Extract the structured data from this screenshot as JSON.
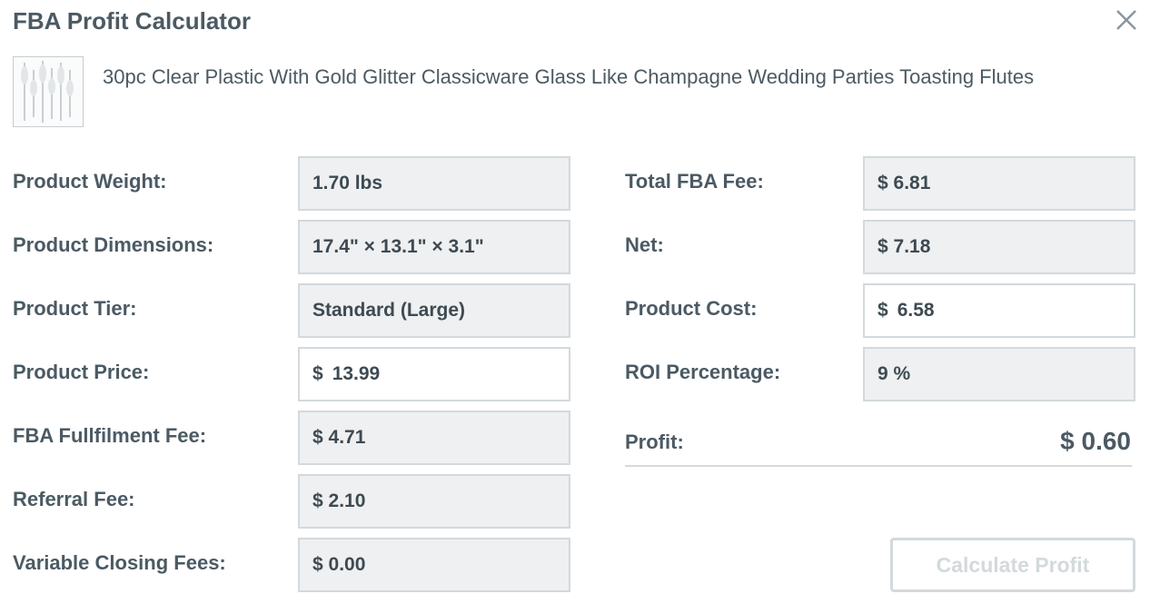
{
  "dialog": {
    "title": "FBA Profit Calculator",
    "product_name": "30pc Clear Plastic With Gold Glitter Classicware Glass Like Champagne Wedding Parties Toasting Flutes"
  },
  "left_fields": [
    {
      "label": "Product Weight:",
      "value": "1.70 lbs"
    },
    {
      "label": "Product Dimensions:",
      "value": "17.4\" × 13.1\" × 3.1\""
    },
    {
      "label": "Product Tier:",
      "value": "Standard (Large)"
    },
    {
      "label": "Product Price:",
      "currency": "$",
      "value": "13.99"
    },
    {
      "label": "FBA Fullfilment Fee:",
      "value": "$ 4.71"
    },
    {
      "label": "Referral Fee:",
      "value": "$ 2.10"
    },
    {
      "label": "Variable Closing Fees:",
      "value": "$ 0.00"
    }
  ],
  "right_fields": [
    {
      "label": "Total FBA Fee:",
      "value": "$ 6.81"
    },
    {
      "label": "Net:",
      "value": "$ 7.18"
    },
    {
      "label": "Product Cost:",
      "currency": "$",
      "value": "6.58"
    },
    {
      "label": "ROI Percentage:",
      "value": "9 %"
    }
  ],
  "profit": {
    "label": "Profit:",
    "value": "$ 0.60"
  },
  "calculate_button": "Calculate Profit",
  "colors": {
    "text": "#4b5a63",
    "readonly_bg": "#eef0f1",
    "border": "#d3d9dc",
    "disabled": "#d3d9dc"
  }
}
